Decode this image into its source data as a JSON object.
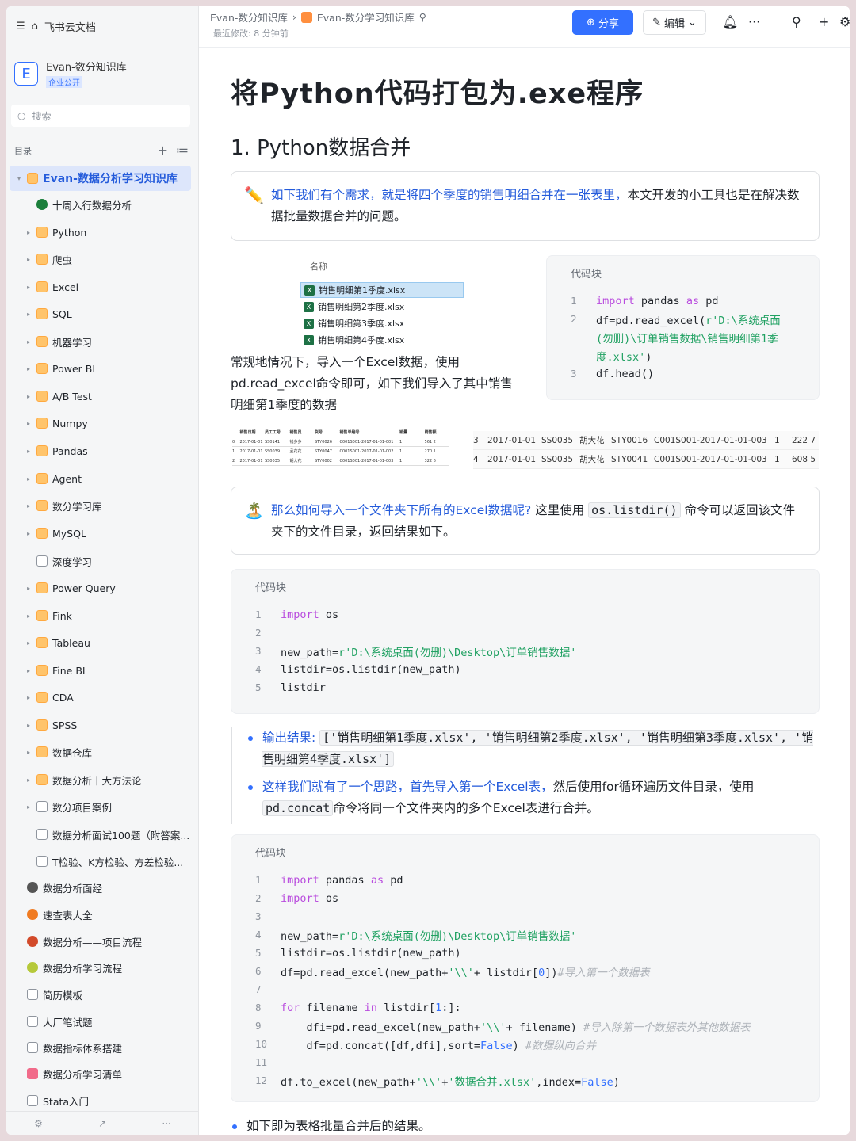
{
  "sidebar": {
    "app_name": "飞书云文档",
    "workspace": {
      "name": "Evan-数分知识库",
      "badge": "企业公开",
      "logo": "E"
    },
    "search_placeholder": "搜索",
    "toc_label": "目录",
    "items": [
      {
        "label": "Evan-数据分析学习知识库",
        "icon": "folder",
        "active": true,
        "level": 0
      },
      {
        "label": "十周入行数据分析",
        "icon": "globe",
        "level": 1
      },
      {
        "label": "Python",
        "icon": "folder",
        "level": 1
      },
      {
        "label": "爬虫",
        "icon": "folder",
        "level": 1
      },
      {
        "label": "Excel",
        "icon": "folder",
        "level": 1
      },
      {
        "label": "SQL",
        "icon": "folder",
        "level": 1
      },
      {
        "label": "机器学习",
        "icon": "folder",
        "level": 1
      },
      {
        "label": "Power BI",
        "icon": "folder",
        "level": 1
      },
      {
        "label": "A/B Test",
        "icon": "folder",
        "level": 1
      },
      {
        "label": "Numpy",
        "icon": "folder",
        "level": 1
      },
      {
        "label": "Pandas",
        "icon": "folder",
        "level": 1
      },
      {
        "label": "Agent",
        "icon": "folder",
        "level": 1
      },
      {
        "label": "数分学习库",
        "icon": "folder",
        "level": 1
      },
      {
        "label": "MySQL",
        "icon": "folder",
        "level": 1
      },
      {
        "label": "深度学习",
        "icon": "doc",
        "level": 1
      },
      {
        "label": "Power Query",
        "icon": "folder",
        "level": 1
      },
      {
        "label": "Fink",
        "icon": "folder",
        "level": 1
      },
      {
        "label": "Tableau",
        "icon": "folder",
        "level": 1
      },
      {
        "label": "Fine BI",
        "icon": "folder",
        "level": 1
      },
      {
        "label": "CDA",
        "icon": "folder",
        "level": 1
      },
      {
        "label": "SPSS",
        "icon": "folder",
        "level": 1
      },
      {
        "label": "数据仓库",
        "icon": "folder",
        "level": 1
      },
      {
        "label": "数据分析十大方法论",
        "icon": "folder",
        "level": 1
      },
      {
        "label": "数分项目案例",
        "icon": "ship",
        "level": 1
      },
      {
        "label": "数据分析面试100题（附答案...",
        "icon": "doc",
        "level": 1
      },
      {
        "label": "T检验、K方检验、方差检验...",
        "icon": "doc",
        "level": 1
      },
      {
        "label": "数据分析面经",
        "icon": "search",
        "level": 0
      },
      {
        "label": "速查表大全",
        "icon": "orange",
        "level": 0
      },
      {
        "label": "数据分析——项目流程",
        "icon": "apple",
        "level": 0
      },
      {
        "label": "数据分析学习流程",
        "icon": "green",
        "level": 0
      },
      {
        "label": "简历模板",
        "icon": "house",
        "level": 0
      },
      {
        "label": "大厂笔试题",
        "icon": "doc",
        "level": 0
      },
      {
        "label": "数据指标体系搭建",
        "icon": "doc",
        "level": 0
      },
      {
        "label": "数据分析学习清单",
        "icon": "pink",
        "level": 0
      },
      {
        "label": "Stata入门",
        "icon": "doc",
        "level": 0
      }
    ]
  },
  "topbar": {
    "breadcrumb": [
      "Evan-数分知识库",
      "Evan-数分学习知识库"
    ],
    "edited": "最近修改: 8 分钟前",
    "share_label": "分享",
    "edit_label": "编辑"
  },
  "doc": {
    "title": "将Python代码打包为.exe程序",
    "h1": "1. Python数据合并",
    "callout1": {
      "emoji": "✏️",
      "highlight": "如下我们有个需求，就是将四个季度的销售明细合并在一张表里，",
      "rest": "本文开发的小工具也是在解决数据批量数据合并的问题。"
    },
    "files": {
      "header": "名称",
      "items": [
        "销售明细第1季度.xlsx",
        "销售明细第2季度.xlsx",
        "销售明细第3季度.xlsx",
        "销售明细第4季度.xlsx"
      ]
    },
    "para1": "常规地情况下，导入一个Excel数据，使用pd.read_excel命令即可，如下我们导入了其中销售明细第1季度的数据",
    "code_label": "代码块",
    "tiny_table": {
      "headers": [
        "",
        "销售日期",
        "员工工号",
        "销售员",
        "货号",
        "销售单编号",
        "销量",
        "销售额"
      ],
      "rows": [
        [
          "0",
          "2017-01-01",
          "SS0141",
          "钱多多",
          "STY0026",
          "C001S001-2017-01-01-001",
          "1",
          "561 2"
        ],
        [
          "1",
          "2017-01-01",
          "SS0039",
          "孟花花",
          "STY0047",
          "C001S001-2017-01-01-002",
          "1",
          "270 1"
        ],
        [
          "2",
          "2017-01-01",
          "SS0035",
          "胡大花",
          "STY0002",
          "C001S001-2017-01-01-003",
          "1",
          "322 6"
        ]
      ]
    },
    "right_table": {
      "rows": [
        [
          "3",
          "2017-01-01",
          "SS0035",
          "胡大花",
          "STY0016",
          "C001S001-2017-01-01-003",
          "1",
          "222 7"
        ],
        [
          "4",
          "2017-01-01",
          "SS0035",
          "胡大花",
          "STY0041",
          "C001S001-2017-01-01-003",
          "1",
          "608 5"
        ]
      ]
    },
    "callout2": {
      "emoji": "🏝️",
      "highlight": "那么如何导入一个文件夹下所有的Excel数据呢?",
      "mid": " 这里使用 ",
      "code": "os.listdir()",
      "rest": " 命令可以返回该文件夹下的文件目录，返回结果如下。"
    },
    "bullet1": {
      "label": "输出结果:",
      "code": "['销售明细第1季度.xlsx', '销售明细第2季度.xlsx', '销售明细第3季度.xlsx', '销售明细第4季度.xlsx']"
    },
    "bullet2": {
      "highlight": "这样我们就有了一个思路，首先导入第一个Excel表，",
      "rest": "然后使用for循环遍历文件目录，使用",
      "code": "pd.concat",
      "rest2": "命令将同一个文件夹内的多个Excel表进行合并。"
    },
    "bullet3": "如下即为表格批量合并后的结果。"
  },
  "colors": {
    "accent": "#3370ff",
    "keyword": "#b94cde",
    "string": "#20a162",
    "comment": "#aeb3b9"
  }
}
